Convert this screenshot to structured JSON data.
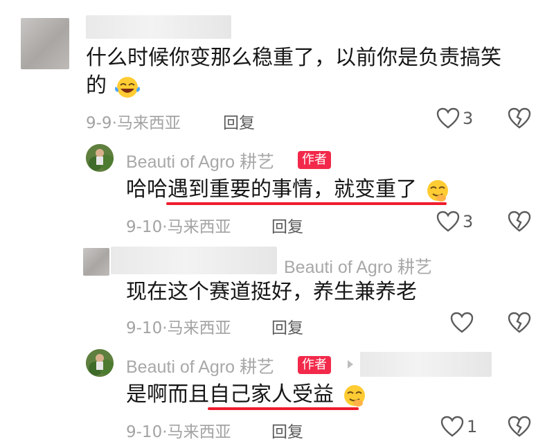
{
  "comments": [
    {
      "text_line1": "什么时候你变那么稳重了，以前你是负责搞笑",
      "text_line2": "的",
      "emoji": "laughing-tears-emoji",
      "meta": "9-9·马来西亚",
      "reply_label": "回复",
      "like_count": "3"
    },
    {
      "author": "Beauti of Agro 耕艺",
      "badge": "作者",
      "text": "哈哈遇到重要的事情，就变重了",
      "emoji": "shush-smile-emoji",
      "meta": "9-10·马来西亚",
      "reply_label": "回复",
      "like_count": "3"
    },
    {
      "reply_to": "Beauti of Agro 耕艺",
      "text": "现在这个赛道挺好，养生兼养老",
      "meta": "9-10·马来西亚",
      "reply_label": "回复"
    },
    {
      "author": "Beauti of Agro 耕艺",
      "badge": "作者",
      "text": "是啊而且自己家人受益",
      "emoji": "shush-smile-emoji",
      "meta": "9-10·马来西亚",
      "reply_label": "回复",
      "like_count": "1"
    }
  ],
  "colors": {
    "badge": "#f2294a",
    "underline": "#ef1c2d",
    "meta": "#a3a3a3"
  },
  "icons": [
    "heart-outline-icon",
    "broken-heart-icon",
    "play-triangle-icon"
  ]
}
